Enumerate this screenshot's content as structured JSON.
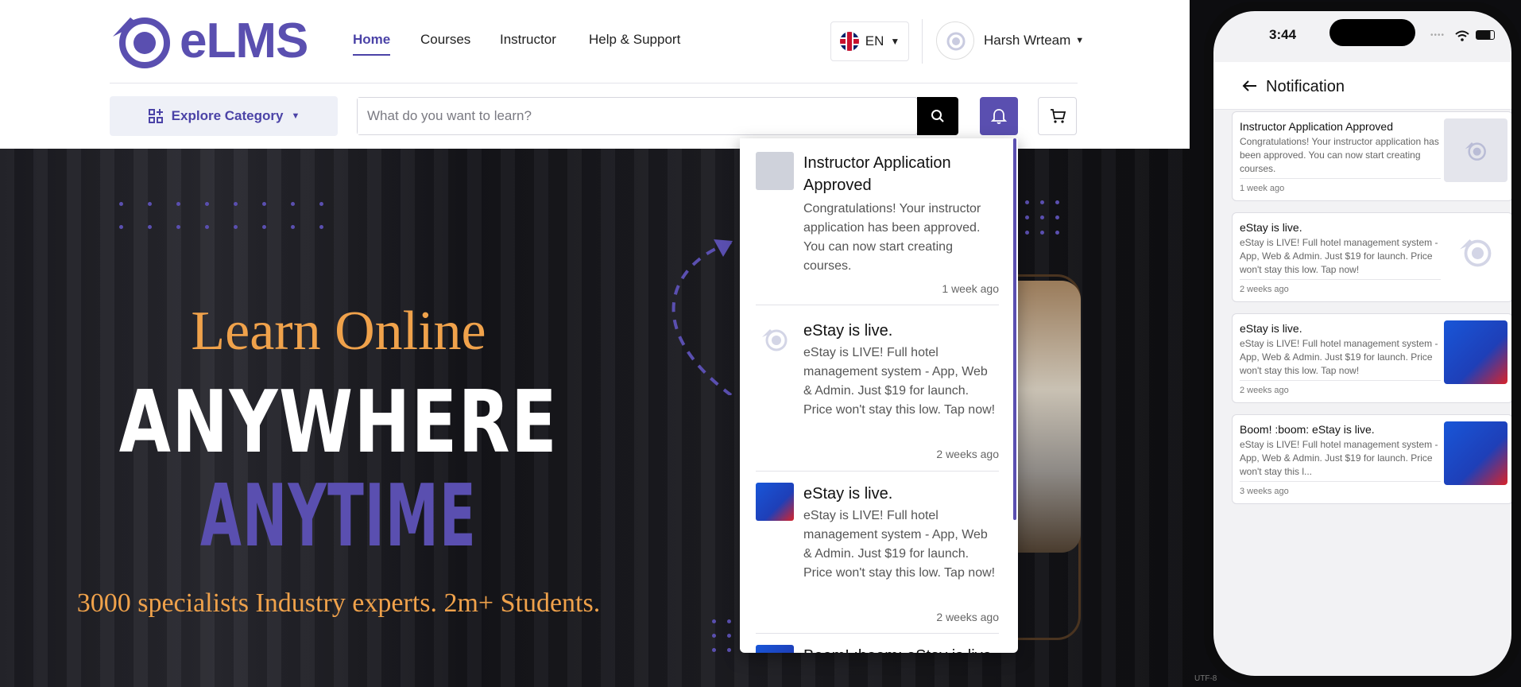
{
  "header": {
    "logo_text": "eLMS",
    "nav": [
      {
        "label": "Home",
        "active": true
      },
      {
        "label": "Courses",
        "active": false
      },
      {
        "label": "Instructor",
        "active": false
      },
      {
        "label": "Help & Support",
        "active": false
      }
    ],
    "language": "EN",
    "user_name": "Harsh Wrteam",
    "explore_label": "Explore Category",
    "search_placeholder": "What do you want to learn?"
  },
  "hero": {
    "line1": "Learn Online",
    "line2": "ANYWHERE",
    "line3": "ANYTIME",
    "subline": "3000 specialists Industry experts. 2m+ Students."
  },
  "dropdown": {
    "items": [
      {
        "title": "Instructor Application Approved",
        "body": "Congratulations! Your instructor application has been approved. You can now start creating courses.",
        "time": "1 week ago"
      },
      {
        "title": "eStay is live.",
        "body": "eStay is LIVE! Full hotel management system - App, Web & Admin. Just $19 for launch. Price won't stay this low. Tap now!",
        "time": "2 weeks ago"
      },
      {
        "title": "eStay is live.",
        "body": "eStay is LIVE! Full hotel management system - App, Web & Admin. Just $19 for launch. Price won't stay this low. Tap now!",
        "time": "2 weeks ago"
      },
      {
        "title": "Boom! :boom: eStay is live.",
        "body": "",
        "time": ""
      }
    ]
  },
  "phone": {
    "status_time": "3:44",
    "title": "Notification",
    "cards": [
      {
        "title": "Instructor Application Approved",
        "body": "Congratulations! Your instructor application has been approved. You can now start creating courses.",
        "time": "1 week ago"
      },
      {
        "title": "eStay is live.",
        "body": "eStay is LIVE! Full hotel management system - App, Web & Admin. Just $19 for launch. Price won't stay this low. Tap now!",
        "time": "2 weeks ago"
      },
      {
        "title": "eStay is live.",
        "body": "eStay is LIVE! Full hotel management system - App, Web & Admin. Just $19 for launch. Price won't stay this low. Tap now!",
        "time": "2 weeks ago"
      },
      {
        "title": "Boom! :boom: eStay is live.",
        "body": "eStay is LIVE! Full hotel management system - App, Web & Admin. Just $19 for launch. Price won't stay this l...",
        "time": "3 weeks ago"
      }
    ]
  },
  "footer_hint": "UTF-8",
  "colors": {
    "brand": "#5a4fb0",
    "accent": "#f0a24b"
  }
}
